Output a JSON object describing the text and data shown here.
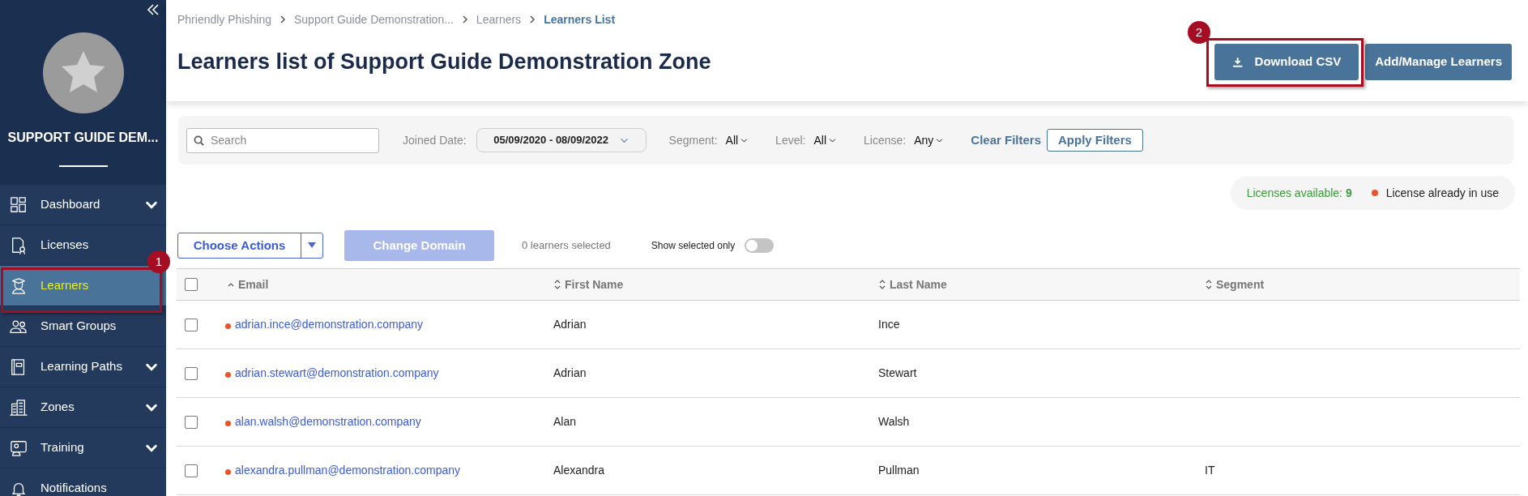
{
  "sidebar": {
    "zone_name": "SUPPORT GUIDE DEM...",
    "items": [
      {
        "label": "Dashboard",
        "expandable": true,
        "selected": false
      },
      {
        "label": "Licenses",
        "expandable": false,
        "selected": false
      },
      {
        "label": "Learners",
        "expandable": false,
        "selected": true
      },
      {
        "label": "Smart Groups",
        "expandable": false,
        "selected": false
      },
      {
        "label": "Learning Paths",
        "expandable": true,
        "selected": false
      },
      {
        "label": "Zones",
        "expandable": true,
        "selected": false
      },
      {
        "label": "Training",
        "expandable": true,
        "selected": false
      },
      {
        "label": "Notifications",
        "expandable": false,
        "selected": false
      }
    ]
  },
  "breadcrumb": [
    "Phriendly Phishing",
    "Support Guide Demonstration...",
    "Learners",
    "Learners List"
  ],
  "title": "Learners list of Support Guide Demonstration Zone",
  "header_buttons": [
    "Download CSV",
    "Add/Manage Learners"
  ],
  "filters": {
    "search_placeholder": "Search",
    "joined_label": "Joined Date:",
    "joined_value": "05/09/2020 - 08/09/2022",
    "dropdowns": [
      {
        "label": "Segment:",
        "value": "All"
      },
      {
        "label": "Level:",
        "value": "All"
      },
      {
        "label": "License:",
        "value": "Any"
      }
    ],
    "clear": "Clear Filters",
    "apply": "Apply Filters"
  },
  "legend": {
    "available_label": "Licenses available:",
    "available_count": "9",
    "in_use": {
      "label": "License already in use",
      "color": "#e8552d"
    }
  },
  "actions": {
    "choose": "Choose Actions",
    "change_domain": "Change Domain",
    "change_domain_disabled": true,
    "selected_count": "0 learners selected",
    "show_selected_label": "Show selected only",
    "show_selected_on": false
  },
  "table": {
    "all_checked": false,
    "columns": [
      {
        "label": "Email",
        "sorted_ascending": true
      },
      {
        "label": "First Name",
        "sorted_ascending": false
      },
      {
        "label": "Last Name",
        "sorted_ascending": false
      },
      {
        "label": "Segment",
        "sorted_ascending": false
      }
    ],
    "rows": [
      {
        "checked": false,
        "license_in_use": true,
        "email": "adrian.ince@demonstration.company",
        "first": "Adrian",
        "last": "Ince"
      },
      {
        "checked": false,
        "license_in_use": true,
        "email": "adrian.stewart@demonstration.company",
        "first": "Adrian",
        "last": "Stewart"
      },
      {
        "checked": false,
        "license_in_use": true,
        "email": "alan.walsh@demonstration.company",
        "first": "Alan",
        "last": "Walsh"
      },
      {
        "checked": false,
        "license_in_use": true,
        "email": "alexandra.pullman@demonstration.company",
        "first": "Alexandra",
        "last": "Pullman",
        "segment": "IT"
      }
    ]
  },
  "annotations": [
    {
      "number": "1"
    },
    {
      "number": "2"
    }
  ]
}
